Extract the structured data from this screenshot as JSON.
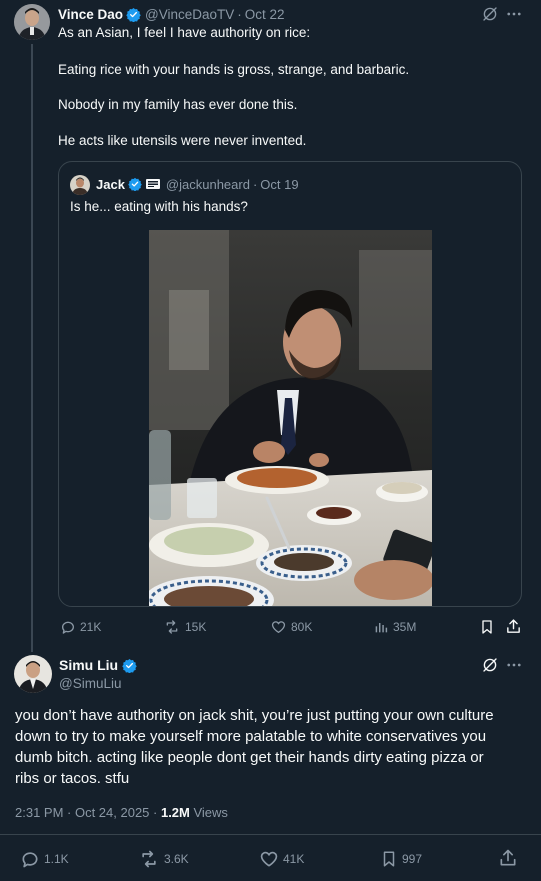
{
  "top_tweet": {
    "author_name": "Vince Dao",
    "handle": "@VinceDaoTV",
    "date": "Oct 22",
    "lines": [
      "As an Asian, I feel I have authority on rice:",
      "Eating rice with your hands is gross, strange, and barbaric.",
      "Nobody in my family has ever done this.",
      "He acts like utensils were never invented."
    ],
    "quote": {
      "author_name": "Jack",
      "handle": "@jackunheard",
      "date": "Oct 19",
      "text": "Is he... eating with his hands?"
    },
    "stats": {
      "replies": "21K",
      "reposts": "15K",
      "likes": "80K",
      "views": "35M"
    }
  },
  "reply_tweet": {
    "author_name": "Simu Liu",
    "handle": "@SimuLiu",
    "lines": [
      "you don’t have authority on jack shit, you’re just putting your own culture",
      "down to try to make yourself more palatable to white conservatives you",
      "dumb bitch. acting like people dont get their hands dirty eating pizza or",
      "ribs or tacos. stfu"
    ],
    "timestamp": "2:31 PM · Oct 24, 2025 · ",
    "views_count": "1.2M",
    "views_label": " Views",
    "stats": {
      "replies": "1.1K",
      "reposts": "3.6K",
      "likes": "41K",
      "bookmarks": "997"
    }
  },
  "colors": {
    "background": "#15202b",
    "text": "#f7f9f9",
    "muted": "#8b98a5",
    "border": "#38444d",
    "verified": "#1d9bf0"
  },
  "icons": [
    "verified-badge-icon",
    "grok-icon",
    "more-icon",
    "reply-icon",
    "repost-icon",
    "like-icon",
    "views-icon",
    "bookmark-icon",
    "share-icon"
  ]
}
